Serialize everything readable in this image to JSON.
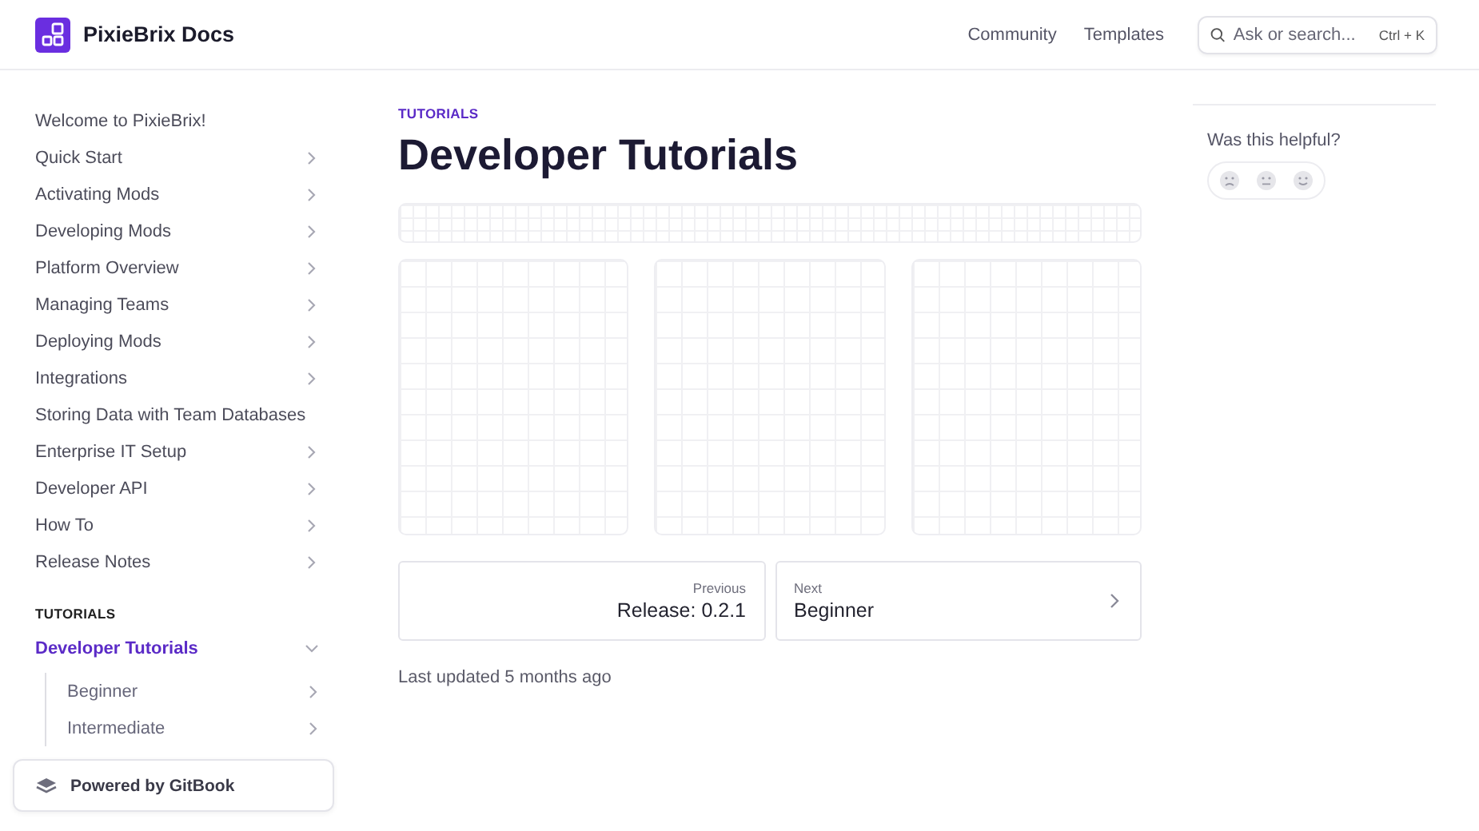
{
  "header": {
    "logo_text": "PixieBrix Docs",
    "links": [
      "Community",
      "Templates"
    ],
    "search": {
      "placeholder": "Ask or search...",
      "shortcut": "Ctrl + K"
    }
  },
  "sidebar": {
    "items": [
      {
        "label": "Welcome to PixieBrix!",
        "selected": false
      },
      {
        "label": "Quick Start",
        "selected": false,
        "expanded": false
      },
      {
        "label": "Activating Mods",
        "selected": false,
        "expanded": false
      },
      {
        "label": "Developing Mods",
        "selected": false,
        "expanded": false
      },
      {
        "label": "Platform Overview",
        "selected": false,
        "expanded": false
      },
      {
        "label": "Managing Teams",
        "selected": false,
        "expanded": false
      },
      {
        "label": "Deploying Mods",
        "selected": false,
        "expanded": false
      },
      {
        "label": "Integrations",
        "selected": false,
        "expanded": false
      },
      {
        "label": "Storing Data with Team Databases",
        "selected": false
      },
      {
        "label": "Enterprise IT Setup",
        "selected": false,
        "expanded": false
      },
      {
        "label": "Developer API",
        "selected": false,
        "expanded": false
      },
      {
        "label": "How To",
        "selected": false,
        "expanded": false
      },
      {
        "label": "Release Notes",
        "selected": false,
        "expanded": false
      }
    ],
    "section_heading": "TUTORIALS",
    "section_items": [
      {
        "label": "Developer Tutorials",
        "selected": true,
        "expanded": true,
        "children": [
          {
            "label": "Beginner",
            "selected": false,
            "expanded": false
          },
          {
            "label": "Intermediate",
            "selected": false,
            "expanded": false
          }
        ]
      }
    ],
    "footer": "Powered by GitBook"
  },
  "main": {
    "breadcrumb": "TUTORIALS",
    "title": "Developer Tutorials",
    "pager": {
      "previous": {
        "caption": "Previous",
        "title": "Release: 0.2.1"
      },
      "next": {
        "caption": "Next",
        "title": "Beginner"
      }
    },
    "last_updated": "Last updated 5 months ago"
  },
  "aside": {
    "feedback_prompt": "Was this helpful?"
  }
}
